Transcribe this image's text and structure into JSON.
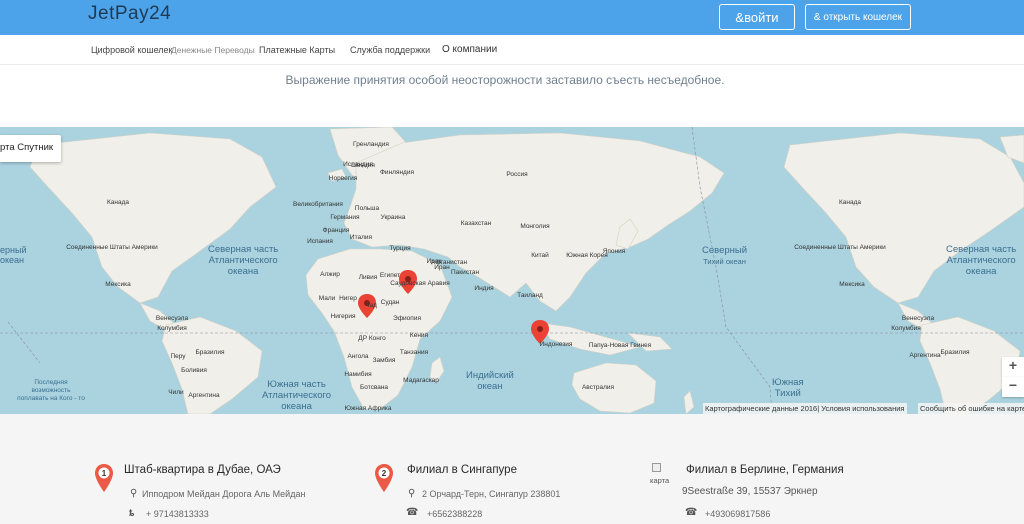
{
  "header": {
    "brand": "JetPay24",
    "login_label": "&войти",
    "open_wallet_label": "& открыть кошелек",
    "bg_color": "#4da3ea"
  },
  "nav": {
    "items": [
      {
        "label": "Цифровой кошелек"
      },
      {
        "label": "Денежные Переводы"
      },
      {
        "label": "Платежные Карты"
      },
      {
        "label": "Служба поддержки"
      },
      {
        "label": "О компании"
      }
    ]
  },
  "slogan": "Выражение принятия особой неосторожности заставило съесть несъедобное.",
  "map": {
    "type_label": "рта  Спутник",
    "zoom_in": "+",
    "zoom_out": "−",
    "attribution": "Картографические данные 2016| Условия использования",
    "report": "Сообщить об ошибке на карте",
    "ocean_labels": [
      "ерный",
      "океан",
      "Северная часть",
      "Атлантического",
      "океана",
      "Северный",
      "Тихий океан",
      "Северная часть",
      "Атлантического",
      "океана",
      "Южная часть",
      "Атлантического",
      "океана",
      "Индийский",
      "океан",
      "Южная",
      "Тихий",
      "Последняя",
      "возможность",
      "поплавать на Кого - то"
    ],
    "country_labels": [
      "Гренландия",
      "Исландия",
      "Швеция",
      "Финляндия",
      "Норвегия",
      "Россия",
      "Польша",
      "Великобритания",
      "Германия",
      "Украина",
      "Франция",
      "Италия",
      "Испания",
      "Казахстан",
      "Монголия",
      "Турция",
      "Афганистан",
      "Китай",
      "Ирак",
      "Иран",
      "Пакистан",
      "Япония",
      "Южная Корея",
      "Индия",
      "Алжир",
      "Ливия",
      "Египет",
      "Саудовская Аравия",
      "Таиланд",
      "Мали",
      "Нигер",
      "Чад",
      "Судан",
      "Нигерия",
      "Эфиопия",
      "Кения",
      "ДР Конго",
      "Танзания",
      "Ангола",
      "Замбия",
      "Намибия",
      "Мадагаскар",
      "Ботсвана",
      "Южная Африка",
      "Индонезия",
      "Папуа-Новая Гвинея",
      "Австралия",
      "Канада",
      "Соединенные Штаты Америки",
      "Мексика",
      "Венесуэла",
      "Колумбия",
      "Перу",
      "Бразилия",
      "Боливия",
      "Аргентина",
      "Чили"
    ]
  },
  "offices": [
    {
      "number": "1",
      "title": "Штаб-квартира в Дубае, ОАЭ",
      "address": "Ипподром Мейдан Дорога Аль Мейдан",
      "phone": "+ 97143813333"
    },
    {
      "number": "2",
      "title": "Филиал в Сингапуре",
      "address": "2 Орчард-Терн, Сингапур 238801",
      "phone": "+6562388228"
    },
    {
      "image_alt": "карта",
      "title": "Филиал в Берлине, Германия",
      "address": "9Seestraße 39, 15537 Эркнер",
      "phone": "+493069817586"
    }
  ]
}
